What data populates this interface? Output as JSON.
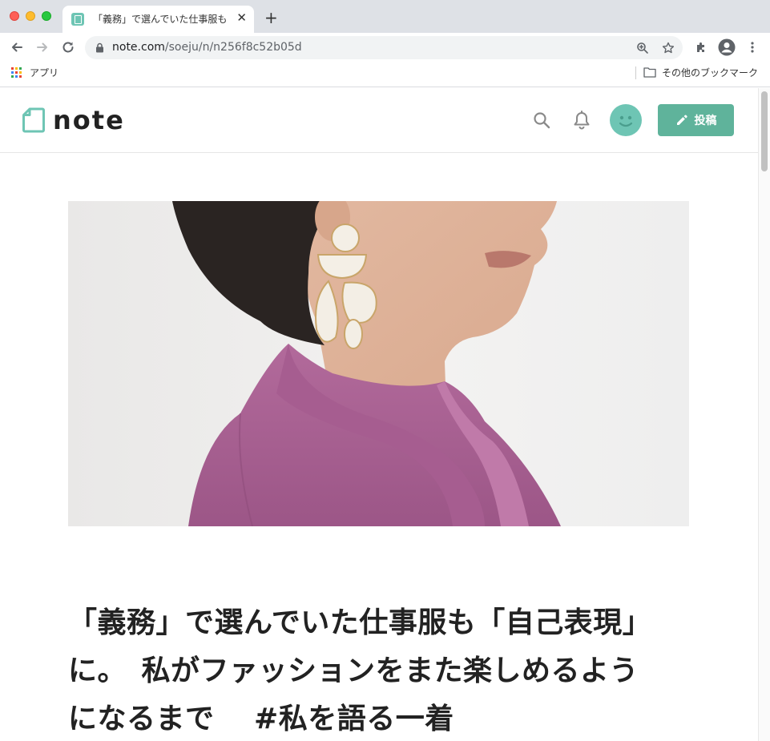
{
  "browser": {
    "tab": {
      "title": "「義務」で選んでいた仕事服も「自己表現」に。私がファッションをまた楽しめるようになるまで",
      "close_glyph": "✕"
    },
    "new_tab_glyph": "+",
    "address": {
      "host": "note.com",
      "path": "/soeju/n/n256f8c52b05d"
    },
    "bookmarks_bar": {
      "apps_label": "アプリ",
      "other_bookmarks_label": "その他のブックマーク"
    }
  },
  "note": {
    "logo_text": "note",
    "post_button_label": "投稿",
    "brand_color": "#5fb39b",
    "avatar_color": "#6ec5b4"
  },
  "article": {
    "title": "「義務」で選んでいた仕事服も「自己表現」\nに。　私がファッションをまた楽しめるよう\nになるまで　 #私を語る一着"
  }
}
